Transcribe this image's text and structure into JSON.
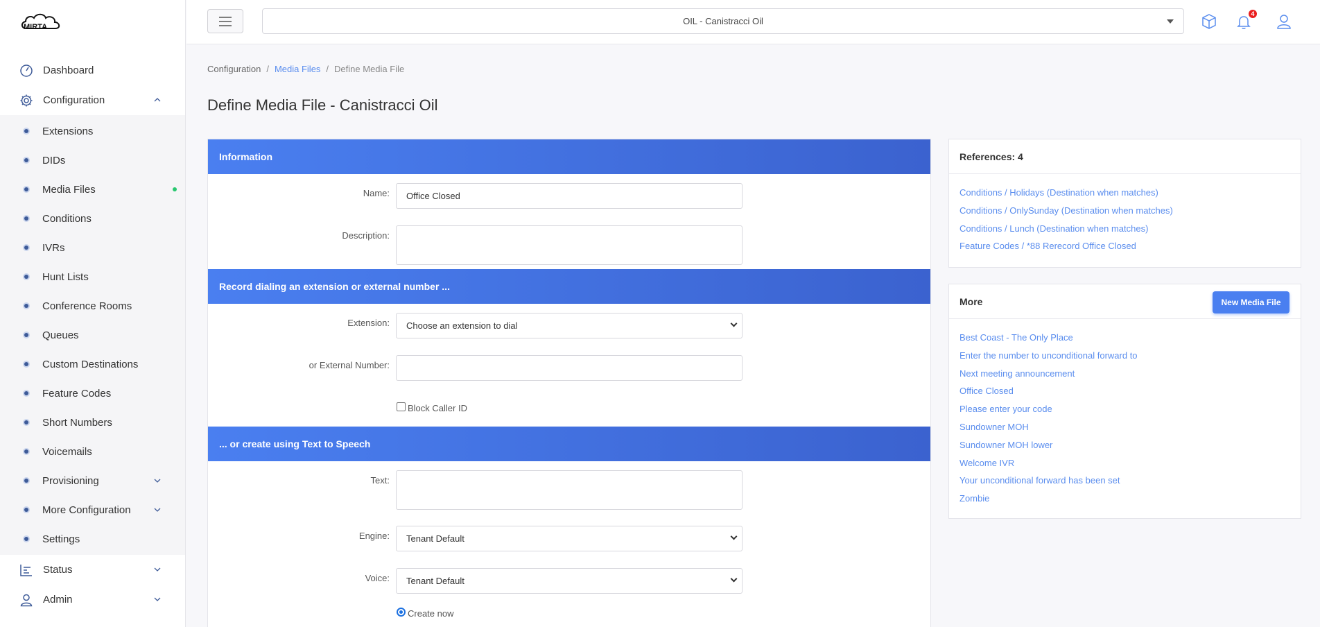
{
  "app": {
    "logo_text": "MIRTA"
  },
  "topbar": {
    "tenant": "OIL - Canistracci Oil",
    "notifications_count": "4"
  },
  "sidebar": {
    "dashboard": "Dashboard",
    "configuration": "Configuration",
    "config_items": [
      {
        "label": "Extensions"
      },
      {
        "label": "DIDs"
      },
      {
        "label": "Media Files"
      },
      {
        "label": "Conditions"
      },
      {
        "label": "IVRs"
      },
      {
        "label": "Hunt Lists"
      },
      {
        "label": "Conference Rooms"
      },
      {
        "label": "Queues"
      },
      {
        "label": "Custom Destinations"
      },
      {
        "label": "Feature Codes"
      },
      {
        "label": "Short Numbers"
      },
      {
        "label": "Voicemails"
      },
      {
        "label": "Provisioning"
      },
      {
        "label": "More Configuration"
      },
      {
        "label": "Settings"
      }
    ],
    "status": "Status",
    "admin": "Admin"
  },
  "breadcrumb": {
    "root": "Configuration",
    "parent": "Media Files",
    "current": "Define Media File"
  },
  "page_title": "Define Media File - Canistracci Oil",
  "form": {
    "info_header": "Information",
    "name_label": "Name:",
    "name_value": "Office Closed",
    "description_label": "Description:",
    "description_value": "",
    "record_header": "Record dialing an extension or external number ...",
    "extension_label": "Extension:",
    "extension_value": "Choose an extension to dial",
    "external_label": "or External Number:",
    "external_value": "",
    "block_caller_id": "Block Caller ID",
    "tts_header": "... or create using Text to Speech",
    "text_label": "Text:",
    "text_value": "",
    "engine_label": "Engine:",
    "engine_value": "Tenant Default",
    "voice_label": "Voice:",
    "voice_value": "Tenant Default",
    "create_now": "Create now"
  },
  "references": {
    "title": "References: 4",
    "items": [
      "Conditions / Holidays (Destination when matches)",
      "Conditions / OnlySunday (Destination when matches)",
      "Conditions / Lunch (Destination when matches)",
      "Feature Codes / *88 Rerecord Office Closed"
    ]
  },
  "more": {
    "title": "More",
    "new_button": "New Media File",
    "items": [
      "Best Coast - The Only Place",
      "Enter the number to unconditional forward to",
      "Next meeting announcement",
      "Office Closed",
      "Please enter your code",
      "Sundowner MOH",
      "Sundowner MOH lower",
      "Welcome IVR",
      "Your unconditional forward has been set",
      "Zombie"
    ]
  },
  "colors": {
    "accent": "#4a7ff0",
    "link": "#5a8dee",
    "active": "#28c76f",
    "badge": "#ea1e1e"
  }
}
